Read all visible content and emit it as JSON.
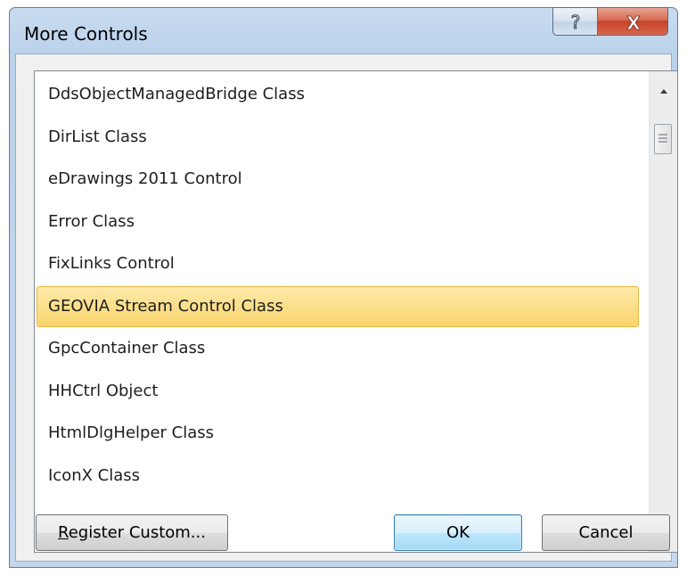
{
  "window": {
    "title": "More Controls",
    "help_glyph": "?",
    "close_glyph": "X"
  },
  "list": {
    "items": [
      "DdsObjectManagedBridge Class",
      "DirList Class",
      "eDrawings 2011 Control",
      "Error Class",
      "FixLinks Control",
      "GEOVIA Stream Control Class",
      "GpcContainer Class",
      "HHCtrl Object",
      "HtmlDlgHelper Class",
      "IconX Class"
    ],
    "selected_index": 5
  },
  "buttons": {
    "register_mnemonic": "R",
    "register_rest": "egister Custom...",
    "ok": "OK",
    "cancel": "Cancel"
  },
  "colors": {
    "selection": "#f9d56e",
    "title_bg": "#b9d1ea",
    "close_button": "#c7432a"
  },
  "icons": [
    "help-icon",
    "close-icon",
    "scroll-up-arrow-icon",
    "scroll-down-arrow-icon",
    "scroll-grip-icon"
  ]
}
